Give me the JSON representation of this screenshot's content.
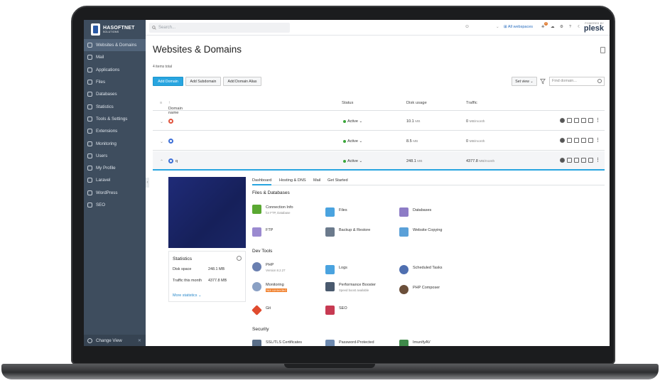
{
  "sidebar": {
    "logo_big": "HASOFTNET",
    "logo_small": "SOLUTIONS",
    "items": [
      {
        "label": "Websites & Domains",
        "icon": "monitor-icon",
        "active": true
      },
      {
        "label": "Mail",
        "icon": "mail-icon"
      },
      {
        "label": "Applications",
        "icon": "applications-icon"
      },
      {
        "label": "Files",
        "icon": "files-icon"
      },
      {
        "label": "Databases",
        "icon": "databases-icon"
      },
      {
        "label": "Statistics",
        "icon": "statistics-icon"
      },
      {
        "label": "Tools & Settings",
        "icon": "tools-icon"
      },
      {
        "label": "Extensions",
        "icon": "extensions-icon"
      },
      {
        "label": "Monitoring",
        "icon": "monitoring-icon"
      },
      {
        "label": "Users",
        "icon": "users-icon"
      },
      {
        "label": "My Profile",
        "icon": "profile-icon"
      },
      {
        "label": "Laravel",
        "icon": "laravel-icon"
      },
      {
        "label": "WordPress",
        "icon": "wordpress-icon"
      },
      {
        "label": "SEO",
        "icon": "seo-icon"
      }
    ],
    "change_view": "Change View"
  },
  "topbar": {
    "search_placeholder": "Search...",
    "webspaces": "All webspaces",
    "powered_by": "POWERED BY",
    "brand": "plesk",
    "badge_count": "2"
  },
  "page": {
    "title": "Websites & Domains",
    "items_total": "4 items total",
    "buttons": {
      "add_domain": "Add Domain",
      "add_subdomain": "Add Subdomain",
      "add_alias": "Add Domain Alias"
    },
    "set_view": "Set view",
    "find_placeholder": "Find domain..."
  },
  "table": {
    "headers": {
      "domain": "Domain name",
      "status": "Status",
      "disk": "Disk usage",
      "traffic": "Traffic"
    },
    "rows": [
      {
        "name": "",
        "status": "Active",
        "disk": "10.1",
        "disk_unit": "MB",
        "traffic": "0",
        "traffic_unit": "MB/month",
        "icon_color": "#e0533d"
      },
      {
        "name": "",
        "status": "Active",
        "disk": "8.5",
        "disk_unit": "MB",
        "traffic": "0",
        "traffic_unit": "MB/month",
        "icon_color": "#3d6fd6"
      },
      {
        "name": "q",
        "status": "Active",
        "disk": "248.1",
        "disk_unit": "MB",
        "traffic": "4377.8",
        "traffic_unit": "MB/month",
        "icon_color": "#3d6fd6"
      }
    ]
  },
  "stats": {
    "title": "Statistics",
    "disk_label": "Disk space",
    "disk_value": "248.1 MB",
    "traffic_label": "Traffic this month",
    "traffic_value": "4377.8 MB",
    "more": "More statistics"
  },
  "tabs": [
    "Dashboard",
    "Hosting & DNS",
    "Mail",
    "Get Started"
  ],
  "sections": {
    "files_db": "Files & Databases",
    "dev_tools": "Dev Tools",
    "security": "Security"
  },
  "tiles": {
    "connection_info": {
      "label": "Connection Info",
      "sub": "for FTP, Database"
    },
    "files": {
      "label": "Files"
    },
    "databases": {
      "label": "Databases"
    },
    "ftp": {
      "label": "FTP"
    },
    "backup": {
      "label": "Backup & Restore"
    },
    "website_copying": {
      "label": "Website Copying"
    },
    "php": {
      "label": "PHP",
      "sub": "Version 8.2.27"
    },
    "logs": {
      "label": "Logs"
    },
    "scheduled_tasks": {
      "label": "Scheduled Tasks"
    },
    "monitoring": {
      "label": "Monitoring",
      "warn": "Not connected"
    },
    "performance_booster": {
      "label": "Performance Booster",
      "sub": "Speed boost available"
    },
    "php_composer": {
      "label": "PHP Composer"
    },
    "git": {
      "label": "Git"
    },
    "seo": {
      "label": "SEO"
    },
    "ssl": {
      "label": "SSL/TLS Certificates"
    },
    "password_protected": {
      "label": "Password-Protected"
    },
    "imunify": {
      "label": "ImunifyAV"
    }
  }
}
